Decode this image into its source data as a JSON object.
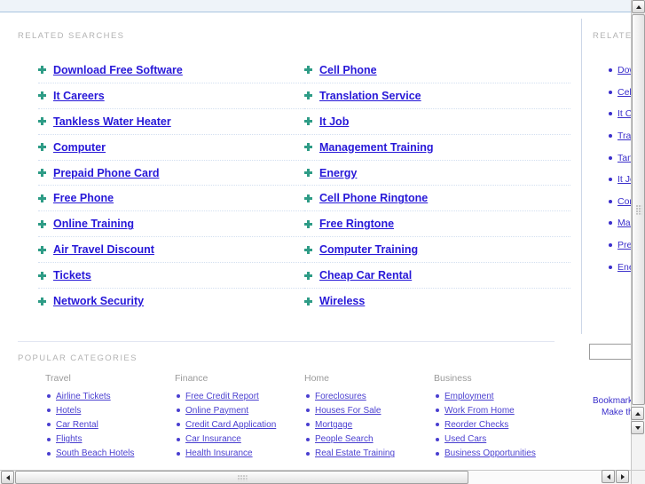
{
  "sections": {
    "related_searches_label": "RELATED SEARCHES",
    "popular_categories_label": "POPULAR CATEGORIES",
    "sidebar_related_label": "RELATED"
  },
  "related_searches": {
    "left_column": [
      "Download Free Software",
      "It Careers",
      "Tankless Water Heater",
      "Computer",
      "Prepaid Phone Card",
      "Free Phone",
      "Online Training",
      "Air Travel Discount",
      "Tickets",
      "Network Security"
    ],
    "right_column": [
      "Cell Phone",
      "Translation Service",
      "It Job",
      "Management Training",
      "Energy",
      "Cell Phone Ringtone",
      "Free Ringtone",
      "Computer Training",
      "Cheap Car Rental",
      "Wireless"
    ]
  },
  "popular_categories": [
    {
      "title": "Travel",
      "items": [
        "Airline Tickets",
        "Hotels",
        "Car Rental",
        "Flights",
        "South Beach Hotels"
      ]
    },
    {
      "title": "Finance",
      "items": [
        "Free Credit Report",
        "Online Payment",
        "Credit Card Application",
        "Car Insurance",
        "Health Insurance"
      ]
    },
    {
      "title": "Home",
      "items": [
        "Foreclosures",
        "Houses For Sale",
        "Mortgage",
        "People Search",
        "Real Estate Training"
      ]
    },
    {
      "title": "Business",
      "items": [
        "Employment",
        "Work From Home",
        "Reorder Checks",
        "Used Cars",
        "Business Opportunities"
      ]
    }
  ],
  "sidebar": {
    "label": "RELATED",
    "items": [
      "Download Free Software",
      "Cell Phone",
      "It Careers",
      "Translation Service",
      "Tankless Water Heater",
      "It Job",
      "Computer",
      "Management Training",
      "Prepaid Phone Card",
      "Energy"
    ],
    "search_value": "",
    "search_placeholder": "",
    "actions": [
      "Bookmark",
      "Make this"
    ]
  },
  "colors": {
    "link_primary": "#2718d8",
    "link_secondary": "#4a3fd0",
    "bullet_plus": "#2e9c86",
    "section_label": "#b3b3b3",
    "top_band": "#eef3f9",
    "top_band_border": "#a9c4e0"
  },
  "scrollbars": {
    "vertical_up_icon": "triangle-up",
    "vertical_down_icon": "triangle-down",
    "horizontal_left_icon": "triangle-left",
    "horizontal_right_icon": "triangle-right"
  }
}
